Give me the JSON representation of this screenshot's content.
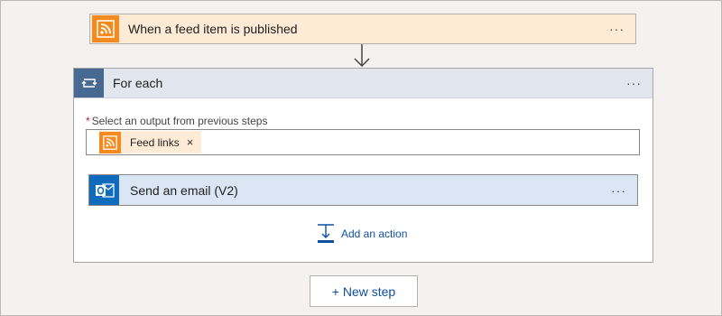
{
  "trigger": {
    "title": "When a feed item is published",
    "icon": "rss-icon",
    "more": "···"
  },
  "foreach": {
    "title": "For each",
    "icon": "loop-icon",
    "more": "···",
    "select_label_required": "*",
    "select_label": "Select an output from previous steps",
    "token": {
      "label": "Feed links",
      "remove": "×",
      "icon": "rss-icon"
    }
  },
  "action": {
    "title": "Send an email (V2)",
    "icon": "outlook-icon",
    "more": "···"
  },
  "add_action": {
    "label": "Add an action",
    "icon": "add-action-icon"
  },
  "new_step": {
    "label": "+ New step"
  },
  "colors": {
    "rss": "#f58b1f",
    "trigger_bg": "#fdebd6",
    "loop_tile": "#486991",
    "foreach_header": "#e1e6ef",
    "action_bg": "#dae6f4",
    "outlook": "#0f6cbd",
    "link": "#0f4fa0"
  }
}
